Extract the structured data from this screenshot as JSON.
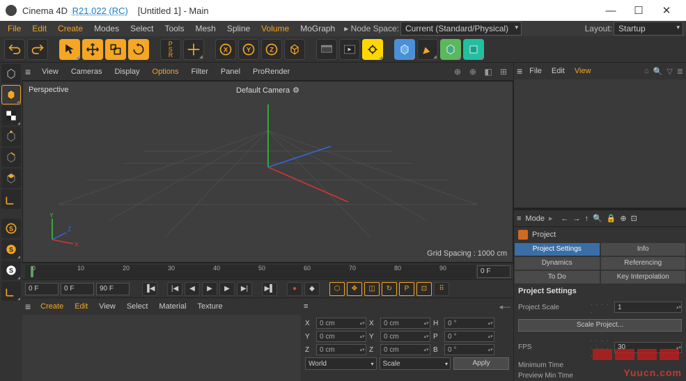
{
  "title": {
    "app": "Cinema 4D",
    "version": "R21.022 (RC)",
    "doc": "[Untitled 1]",
    "view": "Main"
  },
  "winbtns": {
    "min": "—",
    "max": "☐",
    "close": "✕"
  },
  "menu": {
    "items": [
      "File",
      "Edit",
      "Create",
      "Modes",
      "Select",
      "Tools",
      "Mesh",
      "Spline",
      "Volume",
      "MoGraph"
    ],
    "orange_idx": [
      0,
      1,
      2,
      8
    ],
    "nodespace_label": "▸ Node Space:",
    "nodespace_value": "Current (Standard/Physical)",
    "layout_label": "Layout:",
    "layout_value": "Startup"
  },
  "toolbar_icons": [
    "undo",
    "redo",
    "select",
    "move",
    "scale",
    "rotate",
    "psr",
    "axis",
    "x-axis",
    "y-axis",
    "z-axis",
    "cube-prim",
    "render-settings",
    "render-view",
    "render",
    "cube-obj",
    "pen",
    "oil",
    "snap"
  ],
  "left_icons": [
    "model",
    "texture-uv",
    "point",
    "edge",
    "poly",
    "axis",
    "workplane",
    "soft-select",
    "seam",
    "symmetry",
    "snap"
  ],
  "vp_tabs": {
    "items": [
      "View",
      "Cameras",
      "Display",
      "Options",
      "Filter",
      "Panel",
      "ProRender"
    ],
    "orange_idx": [
      3
    ]
  },
  "viewport": {
    "persp": "Perspective",
    "camera": "Default Camera",
    "grid": "Grid Spacing : 1000 cm",
    "axis_y": "Y",
    "axis_z": "Z",
    "axis_x": "X"
  },
  "timeline": {
    "ticks": [
      "0",
      "10",
      "20",
      "30",
      "40",
      "50",
      "60",
      "70",
      "80",
      "90"
    ],
    "start": "0 F",
    "end": "0 F",
    "start2": "0 F",
    "cur": "0 F",
    "end2": "90 F"
  },
  "playback_icons": [
    "goto-start",
    "prev-key",
    "prev-frame",
    "play-back",
    "play-fwd",
    "next-frame",
    "next-key",
    "goto-end",
    "record",
    "autokey",
    "key-pos",
    "key-scale",
    "key-rot",
    "key-param",
    "key-pla",
    "keyframe-sel",
    "grid-snap"
  ],
  "mat_tabs": {
    "items": [
      "Create",
      "Edit",
      "View",
      "Select",
      "Material",
      "Texture"
    ],
    "orange_idx": [
      0,
      1
    ]
  },
  "coords": {
    "rows": [
      {
        "l1": "X",
        "v1": "0 cm",
        "l2": "X",
        "v2": "0 cm",
        "l3": "H",
        "v3": "0 °"
      },
      {
        "l1": "Y",
        "v1": "0 cm",
        "l2": "Y",
        "v2": "0 cm",
        "l3": "P",
        "v3": "0 °"
      },
      {
        "l1": "Z",
        "v1": "0 cm",
        "l2": "Z",
        "v2": "0 cm",
        "l3": "B",
        "v3": "0 °"
      }
    ],
    "sel1": "World",
    "sel2": "Scale",
    "apply": "Apply"
  },
  "obj_tabs": {
    "items": [
      "File",
      "Edit",
      "View"
    ],
    "orange_idx": [
      2
    ]
  },
  "attr_mode": {
    "label": "Mode",
    "project": "Project"
  },
  "attr_tabs": [
    "Project Settings",
    "Info",
    "Dynamics",
    "Referencing",
    "To Do",
    "Key Interpolation"
  ],
  "attr_section": "Project Settings",
  "attr_rows": {
    "scale_label": "Project Scale",
    "scale_val": "1",
    "scale_btn": "Scale Project...",
    "fps_label": "FPS",
    "fps_val": "30",
    "min_label": "Minimum Time",
    "pmin_label": "Preview Min Time"
  },
  "watermark": "Yuucn.com"
}
